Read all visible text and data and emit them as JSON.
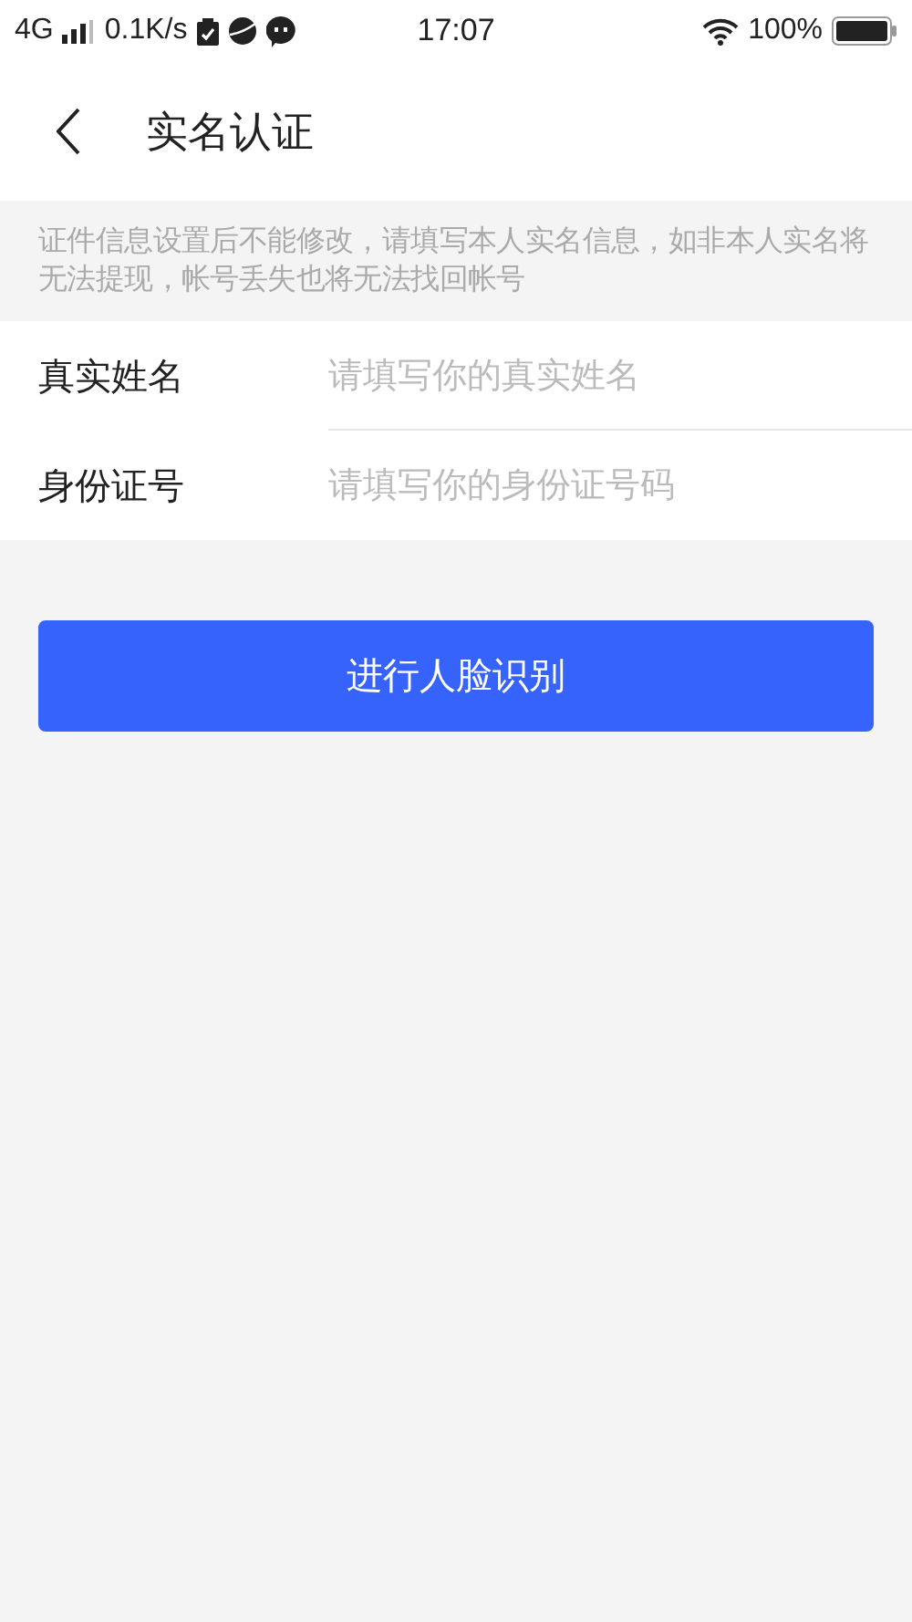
{
  "status_bar": {
    "network": "4G",
    "speed": "0.1K/s",
    "time": "17:07",
    "battery": "100%"
  },
  "header": {
    "title": "实名认证"
  },
  "notice": "证件信息设置后不能修改，请填写本人实名信息，如非本人实名将无法提现，帐号丢失也将无法找回帐号",
  "fields": [
    {
      "label": "真实姓名",
      "placeholder": "请填写你的真实姓名"
    },
    {
      "label": "身份证号",
      "placeholder": "请填写你的身份证号码"
    }
  ],
  "submit_button": "进行人脸识别"
}
